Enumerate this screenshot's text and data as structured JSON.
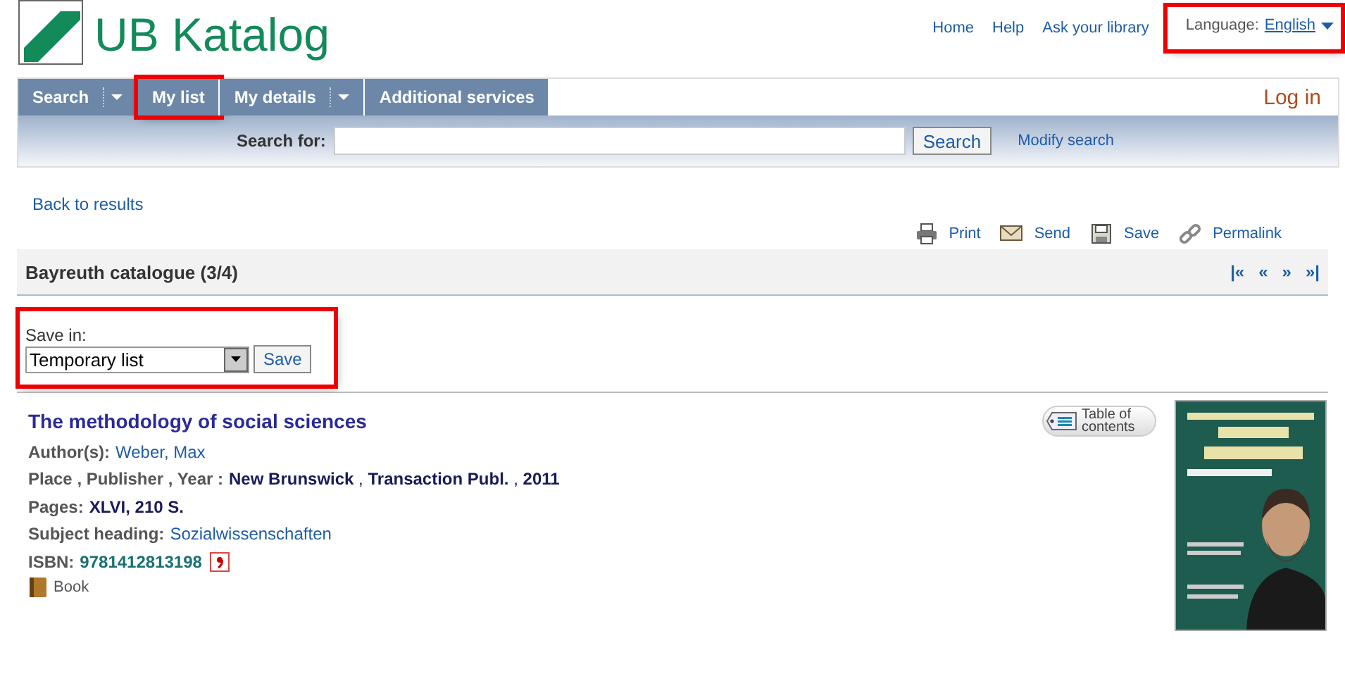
{
  "logo": {
    "text": "UB Katalog"
  },
  "top_links": [
    {
      "label": "Home"
    },
    {
      "label": "Help"
    },
    {
      "label": "Ask your library"
    }
  ],
  "language": {
    "label": "Language:",
    "value": "English",
    "highlighted": true
  },
  "nav_tabs": [
    {
      "label": "Search",
      "selected": false,
      "dropdown": true,
      "highlighted": false
    },
    {
      "label": "My list",
      "selected": false,
      "dropdown": false,
      "highlighted": true
    },
    {
      "label": "My details",
      "selected": false,
      "dropdown": true,
      "highlighted": false
    },
    {
      "label": "Additional services",
      "selected": false,
      "dropdown": false,
      "highlighted": false
    }
  ],
  "login": "Log in",
  "search": {
    "label": "Search for:",
    "button": "Search",
    "modify_link": "Modify search"
  },
  "back_link": "Back to results",
  "actions": [
    {
      "kind": "print",
      "label": "Print"
    },
    {
      "kind": "send",
      "label": "Send"
    },
    {
      "kind": "save",
      "label": "Save"
    },
    {
      "kind": "permalink",
      "label": "Permalink"
    }
  ],
  "result_header": {
    "title": "Bayreuth catalogue (3/4)",
    "pager": [
      "|«",
      "«",
      "»",
      "»|"
    ]
  },
  "save_in": {
    "label": "Save in:",
    "value": "Temporary list",
    "button": "Save",
    "highlighted": true
  },
  "record": {
    "title": "The methodology of social sciences",
    "toc_button": "Table of contents",
    "fields": [
      {
        "kind": "link",
        "label": "Author(s):",
        "value": "Weber, Max"
      },
      {
        "kind": "plain",
        "label": "Place , Publisher , Year :",
        "value": "**New Brunswick** , **Transaction Publ.** , **2011**"
      },
      {
        "kind": "bold",
        "label": "Pages:",
        "value": "XLVI, 210 S."
      },
      {
        "kind": "link",
        "label": "Subject heading:",
        "value": "Sozialwissenschaften"
      },
      {
        "kind": "isbn",
        "label": "ISBN:",
        "value": "9781412813198"
      }
    ],
    "type": "Book"
  }
}
